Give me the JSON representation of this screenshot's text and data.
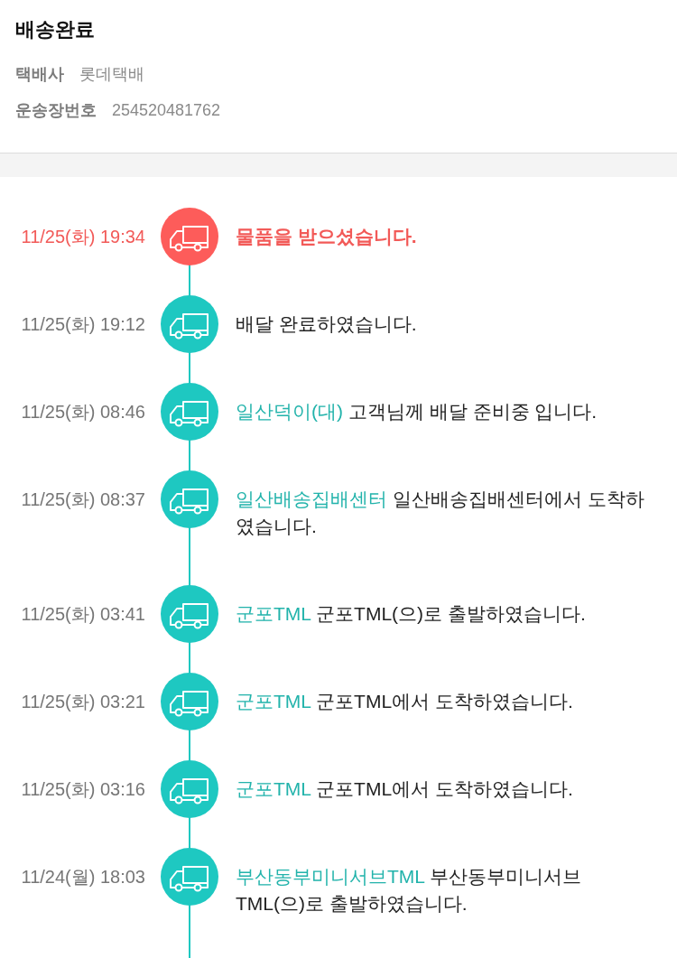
{
  "header": {
    "title": "배송완료",
    "fields": [
      {
        "label": "택배사",
        "value": "롯데택배"
      },
      {
        "label": "운송장번호",
        "value": "254520481762"
      }
    ]
  },
  "timeline": {
    "events": [
      {
        "time": "11/25(화) 19:34",
        "message": "물품을 받으셨습니다.",
        "current": true
      },
      {
        "time": "11/25(화) 19:12",
        "message": "배달 완료하였습니다.",
        "current": false
      },
      {
        "time": "11/25(화) 08:46",
        "location": "일산덕이(대)",
        "message": "고객님께 배달 준비중 입니다.",
        "current": false
      },
      {
        "time": "11/25(화) 08:37",
        "location": "일산배송집배센터",
        "message": "일산배송집배센터에서 도착하였습니다.",
        "current": false
      },
      {
        "time": "11/25(화) 03:41",
        "location": "군포TML",
        "message": "군포TML(으)로 출발하였습니다.",
        "current": false
      },
      {
        "time": "11/25(화) 03:21",
        "location": "군포TML",
        "message": "군포TML에서 도착하였습니다.",
        "current": false
      },
      {
        "time": "11/25(화) 03:16",
        "location": "군포TML",
        "message": "군포TML에서 도착하였습니다.",
        "current": false
      },
      {
        "time": "11/24(월) 18:03",
        "location": "부산동부미니서브TML",
        "message": "부산동부미니서브TML(으)로 출발하였습니다.",
        "current": false
      }
    ]
  }
}
